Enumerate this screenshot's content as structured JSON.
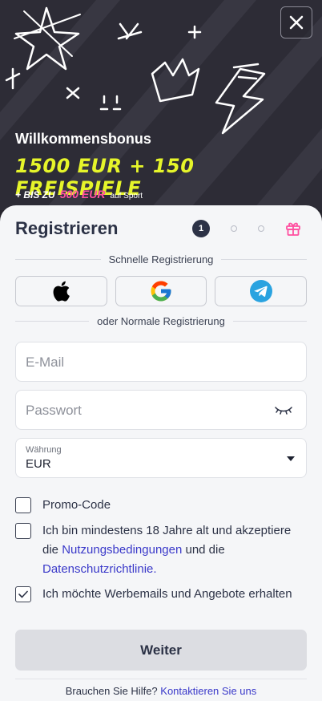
{
  "hero": {
    "title": "Willkommensbonus",
    "main_offer": "1500 EUR + 150 Freispiele",
    "sub_prefix": "+ bis zu",
    "sub_highlight": "500 EUR",
    "sub_suffix": "auf Sport",
    "close_icon": "close-icon"
  },
  "form": {
    "title": "Registrieren",
    "steps": {
      "active": "1",
      "total": 3,
      "final_icon": "gift-icon"
    },
    "quick_label": "Schnelle Registrierung",
    "social": [
      "apple-icon",
      "google-icon",
      "telegram-icon"
    ],
    "normal_label": "oder Normale Registrierung",
    "email_placeholder": "E-Mail",
    "password_placeholder": "Passwort",
    "currency_label": "Währung",
    "currency_value": "EUR",
    "promo_label": "Promo-Code",
    "age_text_1": "Ich bin mindestens 18 Jahre alt und akzeptiere die ",
    "age_link_1": "Nutzungsbedingungen",
    "age_text_2": " und die ",
    "age_link_2": "Datenschutzrichtlinie.",
    "newsletter_label": "Ich möchte Werbemails und Angebote erhalten",
    "newsletter_checked": true,
    "age_checked": false,
    "promo_checked": false,
    "submit_label": "Weiter",
    "help_text": "Brauchen Sie Hilfe?",
    "help_link": "Kontaktieren Sie uns"
  },
  "colors": {
    "accent_yellow": "#e6f52a",
    "accent_pink": "#ff4fa0",
    "link": "#3a39c9",
    "dark": "#2c3246"
  }
}
